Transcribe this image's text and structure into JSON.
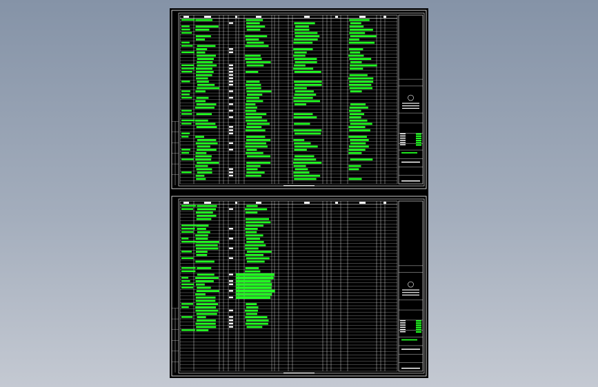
{
  "app": {
    "title": ""
  },
  "colors": {
    "background_top": "#8593a7",
    "background_bottom": "#c4c9d2",
    "paper": "#000000",
    "linework": "#ffffff",
    "text": "#22ff22",
    "accent": "#22dd22"
  },
  "sheets": [
    {
      "id": "sheet-1",
      "rows": 52,
      "density": "full"
    },
    {
      "id": "sheet-2",
      "rows": 52,
      "density": "partial"
    }
  ]
}
